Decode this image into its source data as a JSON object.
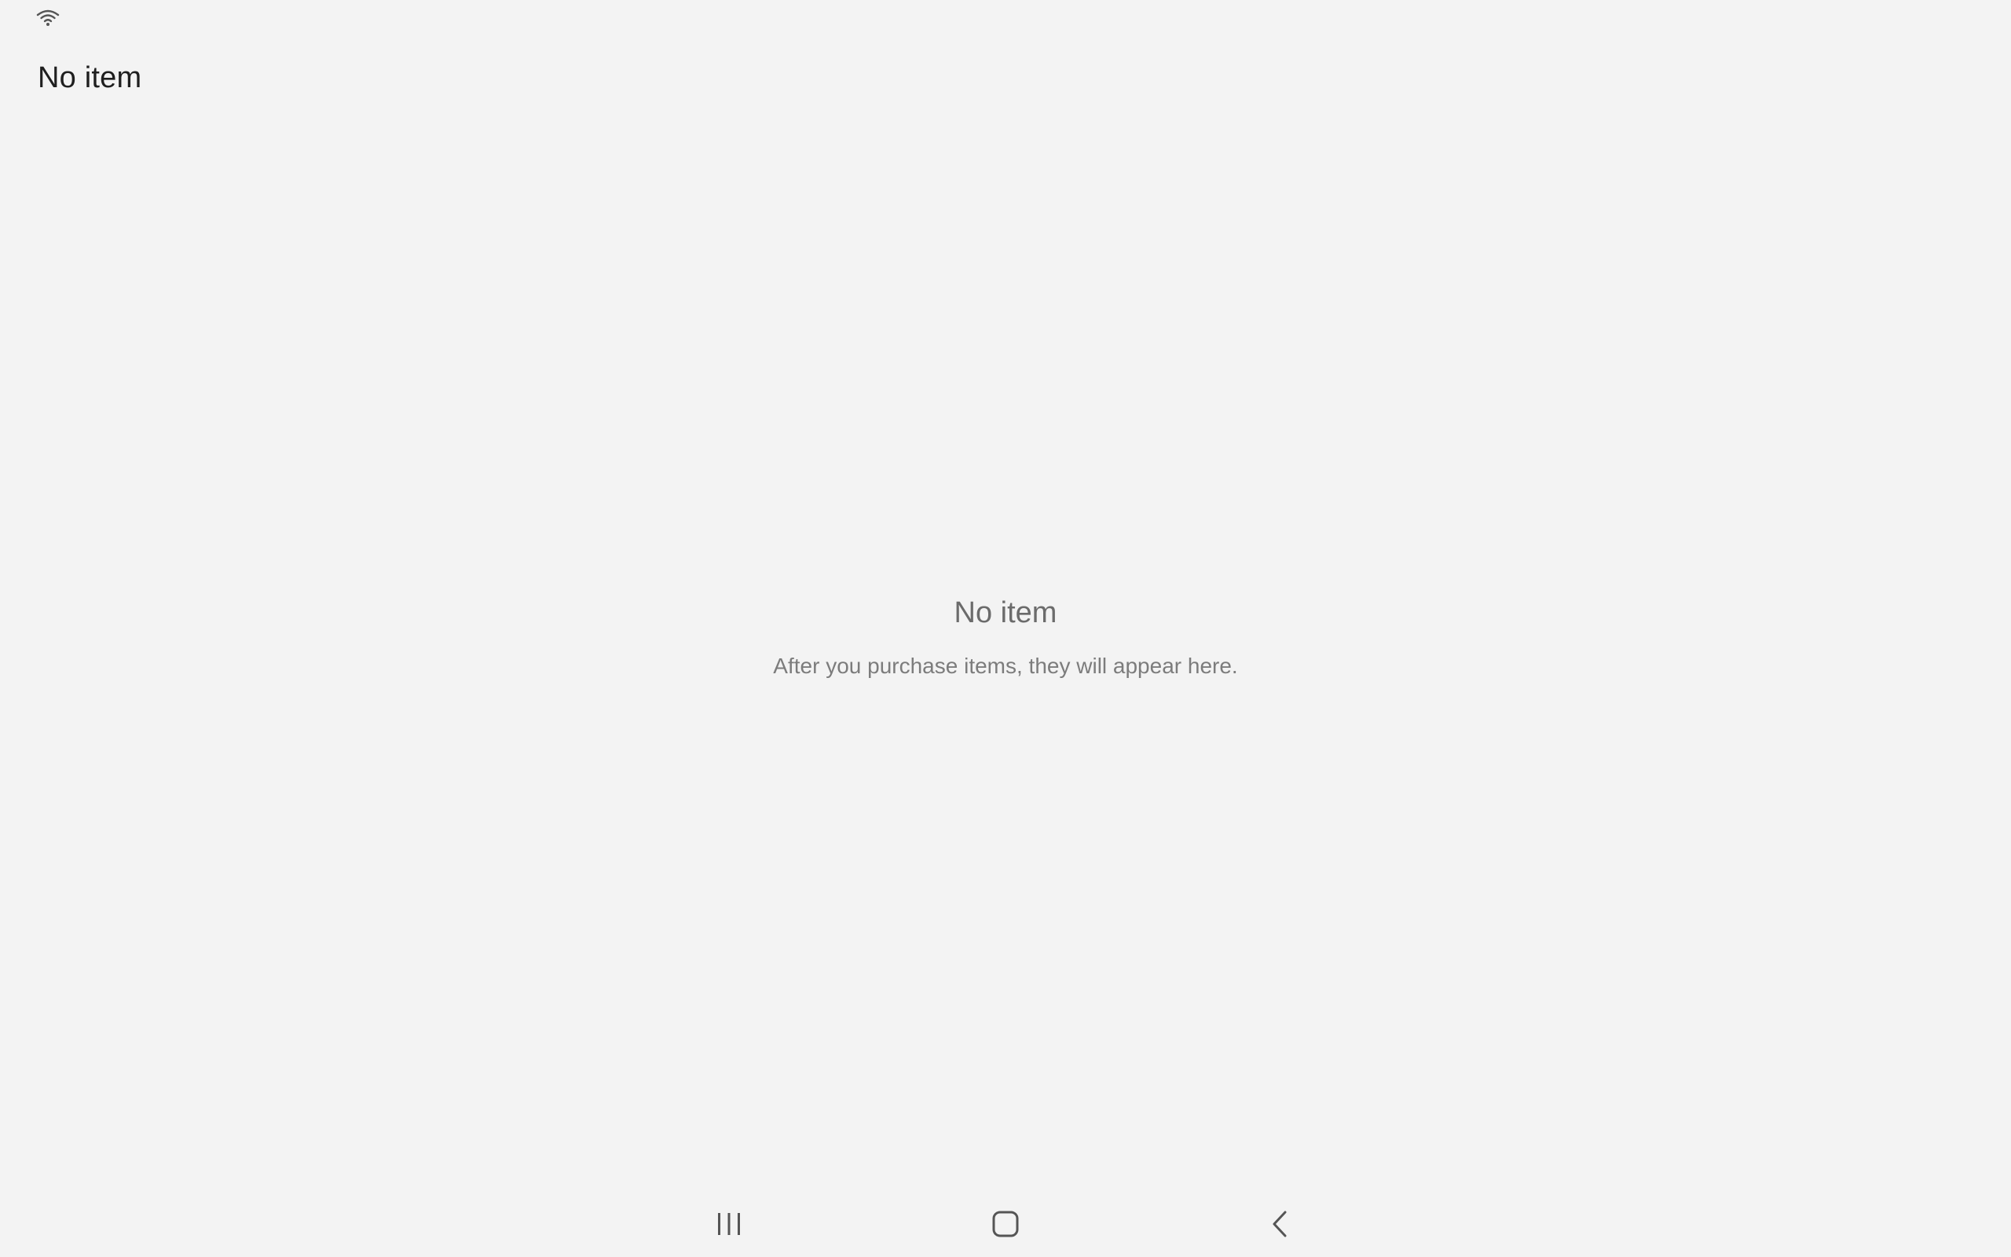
{
  "status_bar": {
    "icons": [
      "wifi-icon"
    ]
  },
  "header": {
    "title": "No item"
  },
  "empty_state": {
    "title": "No item",
    "subtitle": "After you purchase items, they will appear here."
  },
  "nav_bar": {
    "buttons": [
      "recents-icon",
      "home-icon",
      "back-icon"
    ]
  },
  "colors": {
    "background": "#f3f3f3",
    "title_text": "#1f1f1f",
    "muted_text": "#6b6b6b",
    "icon": "#555555"
  }
}
